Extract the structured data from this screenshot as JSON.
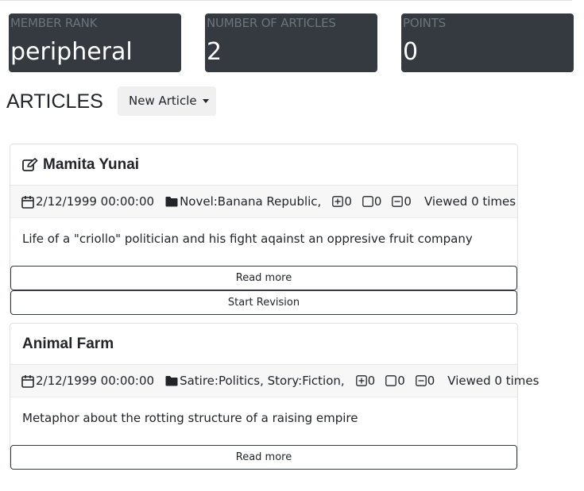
{
  "stats": [
    {
      "label": "MEMBER RANK",
      "value": "peripheral"
    },
    {
      "label": "NUMBER OF ARTICLES",
      "value": "2"
    },
    {
      "label": "POINTS",
      "value": "0"
    }
  ],
  "articles_title": "ARTICLES",
  "new_article_label": "New Article",
  "articles": [
    {
      "title": "Mamita Yunai",
      "date": "2/12/1999 00:00:00",
      "categories": "Novel:Banana Republic,",
      "plus_count": "0",
      "neutral_count": "0",
      "minus_count": "0",
      "viewed": "Viewed 0 times",
      "summary": "Life of a \"criollo\" politician and his fight aqainst an oppresive fruit company",
      "read_more": "Read more",
      "start_revision": "Start Revision"
    },
    {
      "title": "Animal Farm",
      "date": "2/12/1999 00:00:00",
      "categories": "Satire:Politics, Story:Fiction,",
      "plus_count": "0",
      "neutral_count": "0",
      "minus_count": "0",
      "viewed": "Viewed 0 times",
      "summary": "Metaphor about the rotting structure of a raising empire",
      "read_more": "Read more"
    }
  ]
}
